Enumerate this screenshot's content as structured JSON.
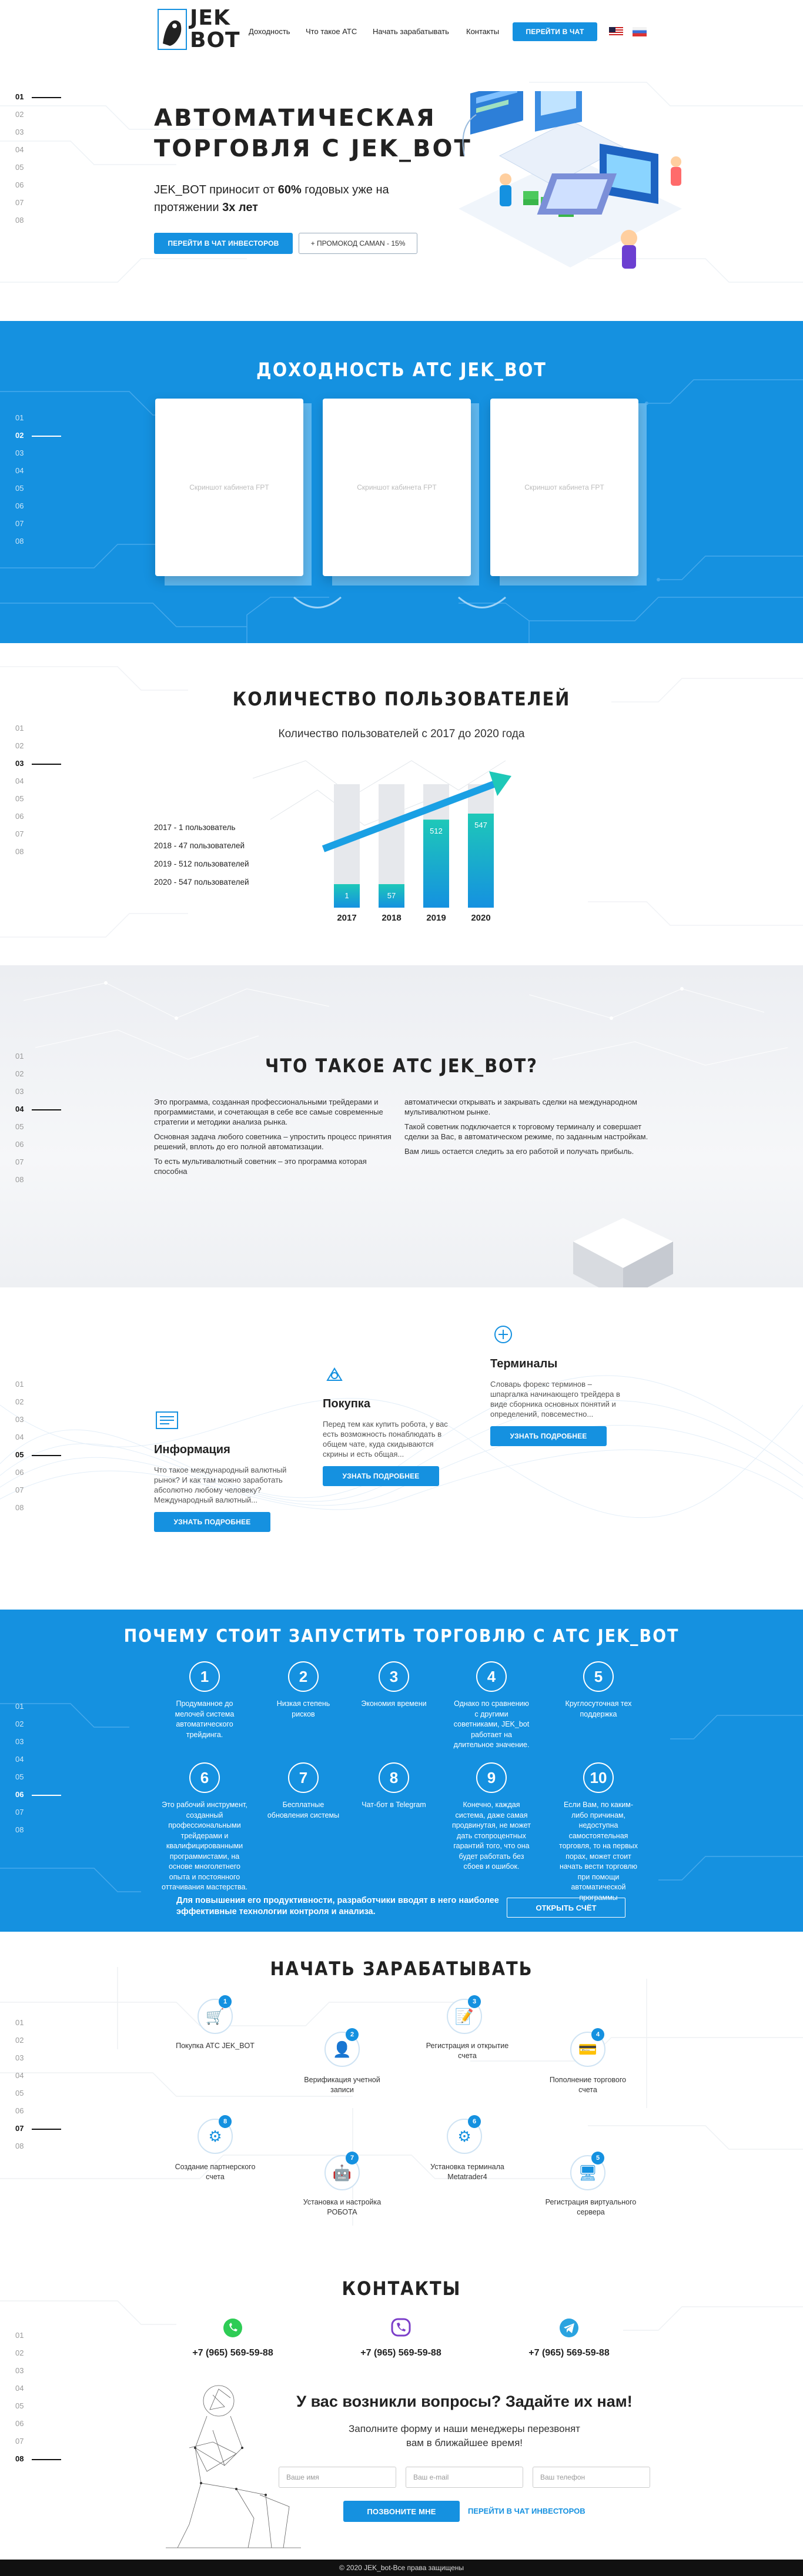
{
  "header": {
    "logo_line1": "JEK",
    "logo_line2": "BOT",
    "nav": [
      "Доходность",
      "Что такое АТС",
      "Начать зарабатывать",
      "Контакты"
    ],
    "cta": "ПЕРЕЙТИ В ЧАТ"
  },
  "side_nav": [
    "01",
    "02",
    "03",
    "04",
    "05",
    "06",
    "07",
    "08"
  ],
  "hero": {
    "title_line1": "АВТОМАТИЧЕСКАЯ",
    "title_line2": "ТОРГОВЛЯ С JEK_BOT",
    "sub_pre": "JEK_BOT приносит от ",
    "sub_bold1": "60%",
    "sub_mid": " годовых уже на протяжении ",
    "sub_bold2": "3х лет",
    "btn_chat": "ПЕРЕЙТИ В ЧАТ ИНВЕСТОРОВ",
    "btn_promo": "+ ПРОМОКОД CAMAN - 15%"
  },
  "profit": {
    "title": "ДОХОДНОСТЬ АТС JEK_BOT",
    "cards": [
      "Скриншот кабинета FPT",
      "Скриншот кабинета FPT",
      "Скриншот кабинета FPT"
    ]
  },
  "users": {
    "title": "КОЛИЧЕСТВО ПОЛЬЗОВАТЕЛЕЙ",
    "subtitle": "Количество пользователей с 2017 до 2020 года",
    "legend": [
      "2017 - 1 пользователь",
      "2018 - 47 пользователей",
      "2019 - 512 пользователей",
      "2020 - 547 пользователей"
    ]
  },
  "chart_data": {
    "type": "bar",
    "categories": [
      "2017",
      "2018",
      "2019",
      "2020"
    ],
    "values": [
      1,
      57,
      512,
      547
    ],
    "title": "Количество пользователей с 2017 до 2020 года"
  },
  "about": {
    "title": "ЧТО ТАКОЕ АТС JEK_BOT?",
    "col1": [
      "Это программа, созданная профессиональными трейдерами и программистами, и сочетающая в себе все самые современные стратегии и методики анализа рынка.",
      "Основная задача любого советника – упростить процесс принятия решений, вплоть до его полной автоматизации.",
      "То есть мультивалютный советник – это программа которая способна"
    ],
    "col2": [
      "автоматически открывать и закрывать сделки на международном мультивалютном рынке.",
      "Такой советник подключается к торговому терминалу и совершает сделки за Вас, в автоматическом режиме, по заданным настройкам.",
      "Вам лишь остается следить за его работой и получать прибыль."
    ]
  },
  "info": {
    "items": [
      {
        "title": "Информация",
        "text": "Что такое международный валютный рынок? И как там можно заработать абсолютно любому человеку? Международный валютный...",
        "btn": "УЗНАТЬ ПОДРОБНЕЕ"
      },
      {
        "title": "Покупка",
        "text": "Перед тем как купить робота, у вас есть возможность понаблюдать в общем чате, куда скидываются скрины и есть общая...",
        "btn": "УЗНАТЬ ПОДРОБНЕЕ"
      },
      {
        "title": "Терминалы",
        "text": "Словарь форекс терминов – шпаргалка начинающего трейдера в виде сборника основных понятий и определений, повсеместно...",
        "btn": "УЗНАТЬ ПОДРОБНЕЕ"
      }
    ]
  },
  "why": {
    "title": "ПОЧЕМУ СТОИТ ЗАПУСТИТЬ ТОРГОВЛЮ С АТС JEK_BOT",
    "reasons": [
      {
        "n": "1",
        "t": "Продуманное до мелочей система автоматического трейдинга."
      },
      {
        "n": "2",
        "t": "Низкая степень рисков"
      },
      {
        "n": "3",
        "t": "Экономия времени"
      },
      {
        "n": "4",
        "t": "Однако по сравнению с другими советниками, JEK_bot работает на длительное значение."
      },
      {
        "n": "5",
        "t": "Круглосуточная тех поддержка"
      },
      {
        "n": "6",
        "t": "Это рабочий инструмент, созданный профессиональными трейдерами и квалифицированными программистами, на основе многолетнего опыта и постоянного оттачивания мастерства."
      },
      {
        "n": "7",
        "t": "Бесплатные обновления системы"
      },
      {
        "n": "8",
        "t": "Чат-бот в Telegram"
      },
      {
        "n": "9",
        "t": "Конечно, каждая система, даже самая продвинутая, не может дать стопроцентных гарантий того, что она будет работать без сбоев и ошибок."
      },
      {
        "n": "10",
        "t": "Если Вам, по каким-либо причинам, недоступна самостоятельная торговля, то на первых порах, может стоит начать вести торговлю при помощи автоматической программы"
      }
    ],
    "bottom_text": "Для повышения его продуктивности, разработчики вводят в него наиболее эффективные технологии контроля и анализа.",
    "btn": "ОТКРЫТЬ СЧЁТ"
  },
  "start": {
    "title": "НАЧАТЬ ЗАРАБАТЫВАТЬ",
    "steps": [
      {
        "n": "1",
        "t": "Покупка АТС JEK_BOT"
      },
      {
        "n": "2",
        "t": "Верификация учетной записи"
      },
      {
        "n": "3",
        "t": "Регистрация и открытие счета"
      },
      {
        "n": "4",
        "t": "Пополнение торгового счета"
      },
      {
        "n": "5",
        "t": "Регистрация виртуального сервера"
      },
      {
        "n": "6",
        "t": "Установка терминала Metatrader4"
      },
      {
        "n": "7",
        "t": "Установка и настройка РОБОТА"
      },
      {
        "n": "8",
        "t": "Создание партнерского счета"
      }
    ]
  },
  "contacts": {
    "title": "КОНТАКТЫ",
    "phones": [
      "+7 (965) 569-59-88",
      "+7 (965) 569-59-88",
      "+7 (965) 569-59-88"
    ],
    "question": "У вас возникли вопросы? Задайте их нам!",
    "question_sub": "Заполните форму и наши менеджеры перезвонят вам в ближайшее время!",
    "ph_name": "Ваше имя",
    "ph_email": "Ваш e-mail",
    "ph_phone": "Ваш телефон",
    "btn_call": "ПОЗВОНИТЕ МНЕ",
    "link_chat": "ПЕРЕЙТИ В ЧАТ ИНВЕСТОРОВ"
  },
  "footer": {
    "text": "© 2020 JEK_bot-Все права защищены"
  },
  "colors": {
    "accent": "#1591e0",
    "teal": "#17c9c0",
    "dark": "#222"
  }
}
